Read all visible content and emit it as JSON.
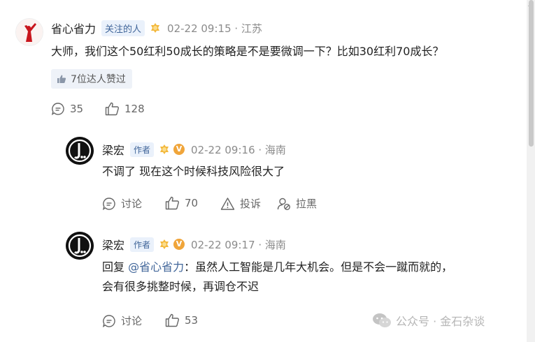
{
  "comments": [
    {
      "user": "省心省力",
      "tag": "关注的人",
      "meta": "02-22 09:15 · 江苏",
      "text": "大师，我们这个50红利50成长的策略是不是要微调一下？比如30红利70成长？",
      "liked_by": "7位达人赞过",
      "comment_count": "35",
      "like_count": "128"
    },
    {
      "user": "梁宏",
      "tag": "作者",
      "verified_badge": "V",
      "meta": "02-22 09:16 · 海南",
      "text": "不调了 现在这个时候科技风险很大了",
      "discuss_label": "讨论",
      "like_count": "70",
      "report_label": "投诉",
      "block_label": "拉黑"
    },
    {
      "user": "梁宏",
      "tag": "作者",
      "verified_badge": "V",
      "meta": "02-22 09:17 · 海南",
      "reply_prefix": "回复 ",
      "mention": "@省心省力",
      "text_line1": "：虽然人工智能是几年大机会。但是不会一蹴而就的，",
      "text_line2": "会有很多挑整时候，再调仓不迟",
      "discuss_label": "讨论",
      "like_count": "53"
    }
  ],
  "watermark": "公众号 · 金石杂谈",
  "colors": {
    "link": "#406599",
    "meta": "#8b8b8b",
    "tag_bg": "#eaf1fb"
  }
}
